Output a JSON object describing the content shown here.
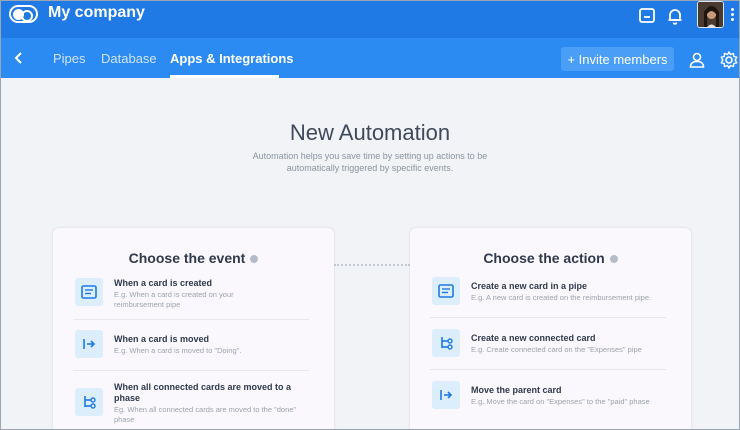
{
  "topbar": {
    "company_name": "My company",
    "icons": [
      "logo-icon",
      "inbox-icon",
      "bell-icon",
      "avatar",
      "more-icon"
    ]
  },
  "navbar": {
    "tabs": [
      {
        "label": "Pipes"
      },
      {
        "label": "Database"
      },
      {
        "label": "Apps & Integrations"
      }
    ],
    "active_tab": "Apps & Integrations",
    "invite_label": "+ Invite members"
  },
  "main": {
    "title": "New Automation",
    "subtitle": "Automation helps you save time by setting up actions to be automatically triggered by specific events."
  },
  "event_card": {
    "title": "Choose the event",
    "options": [
      {
        "icon": "card-icon",
        "title": "When a card is created",
        "desc": "E.g. When a card is created on your reimbursement pipe"
      },
      {
        "icon": "move-icon",
        "title": "When a card is moved",
        "desc": "E.g. When a card is moved to \"Doing\"."
      },
      {
        "icon": "connected-cards-icon",
        "title": "When all connected cards are moved to a phase",
        "desc": "Eg. When all connected cards are moved to the \"done\" phase"
      }
    ]
  },
  "action_card": {
    "title": "Choose the action",
    "options": [
      {
        "icon": "card-icon",
        "title": "Create a new card in a pipe",
        "desc": "E.g. A new card is created on the reimbursement pipe."
      },
      {
        "icon": "connected-cards-icon",
        "title": "Create a new connected card",
        "desc": "E.g. Create connected card on the \"Expenses\" pipe"
      },
      {
        "icon": "move-icon",
        "title": "Move the parent card",
        "desc": "E.g. Move the card on \"Expenses\" to the \"paid\" phase"
      }
    ]
  },
  "colors": {
    "topbar": "#1f7ae6",
    "navbar": "#2c8bf2",
    "accent": "#1f7ae6",
    "icon_bg": "#dcedfc"
  }
}
